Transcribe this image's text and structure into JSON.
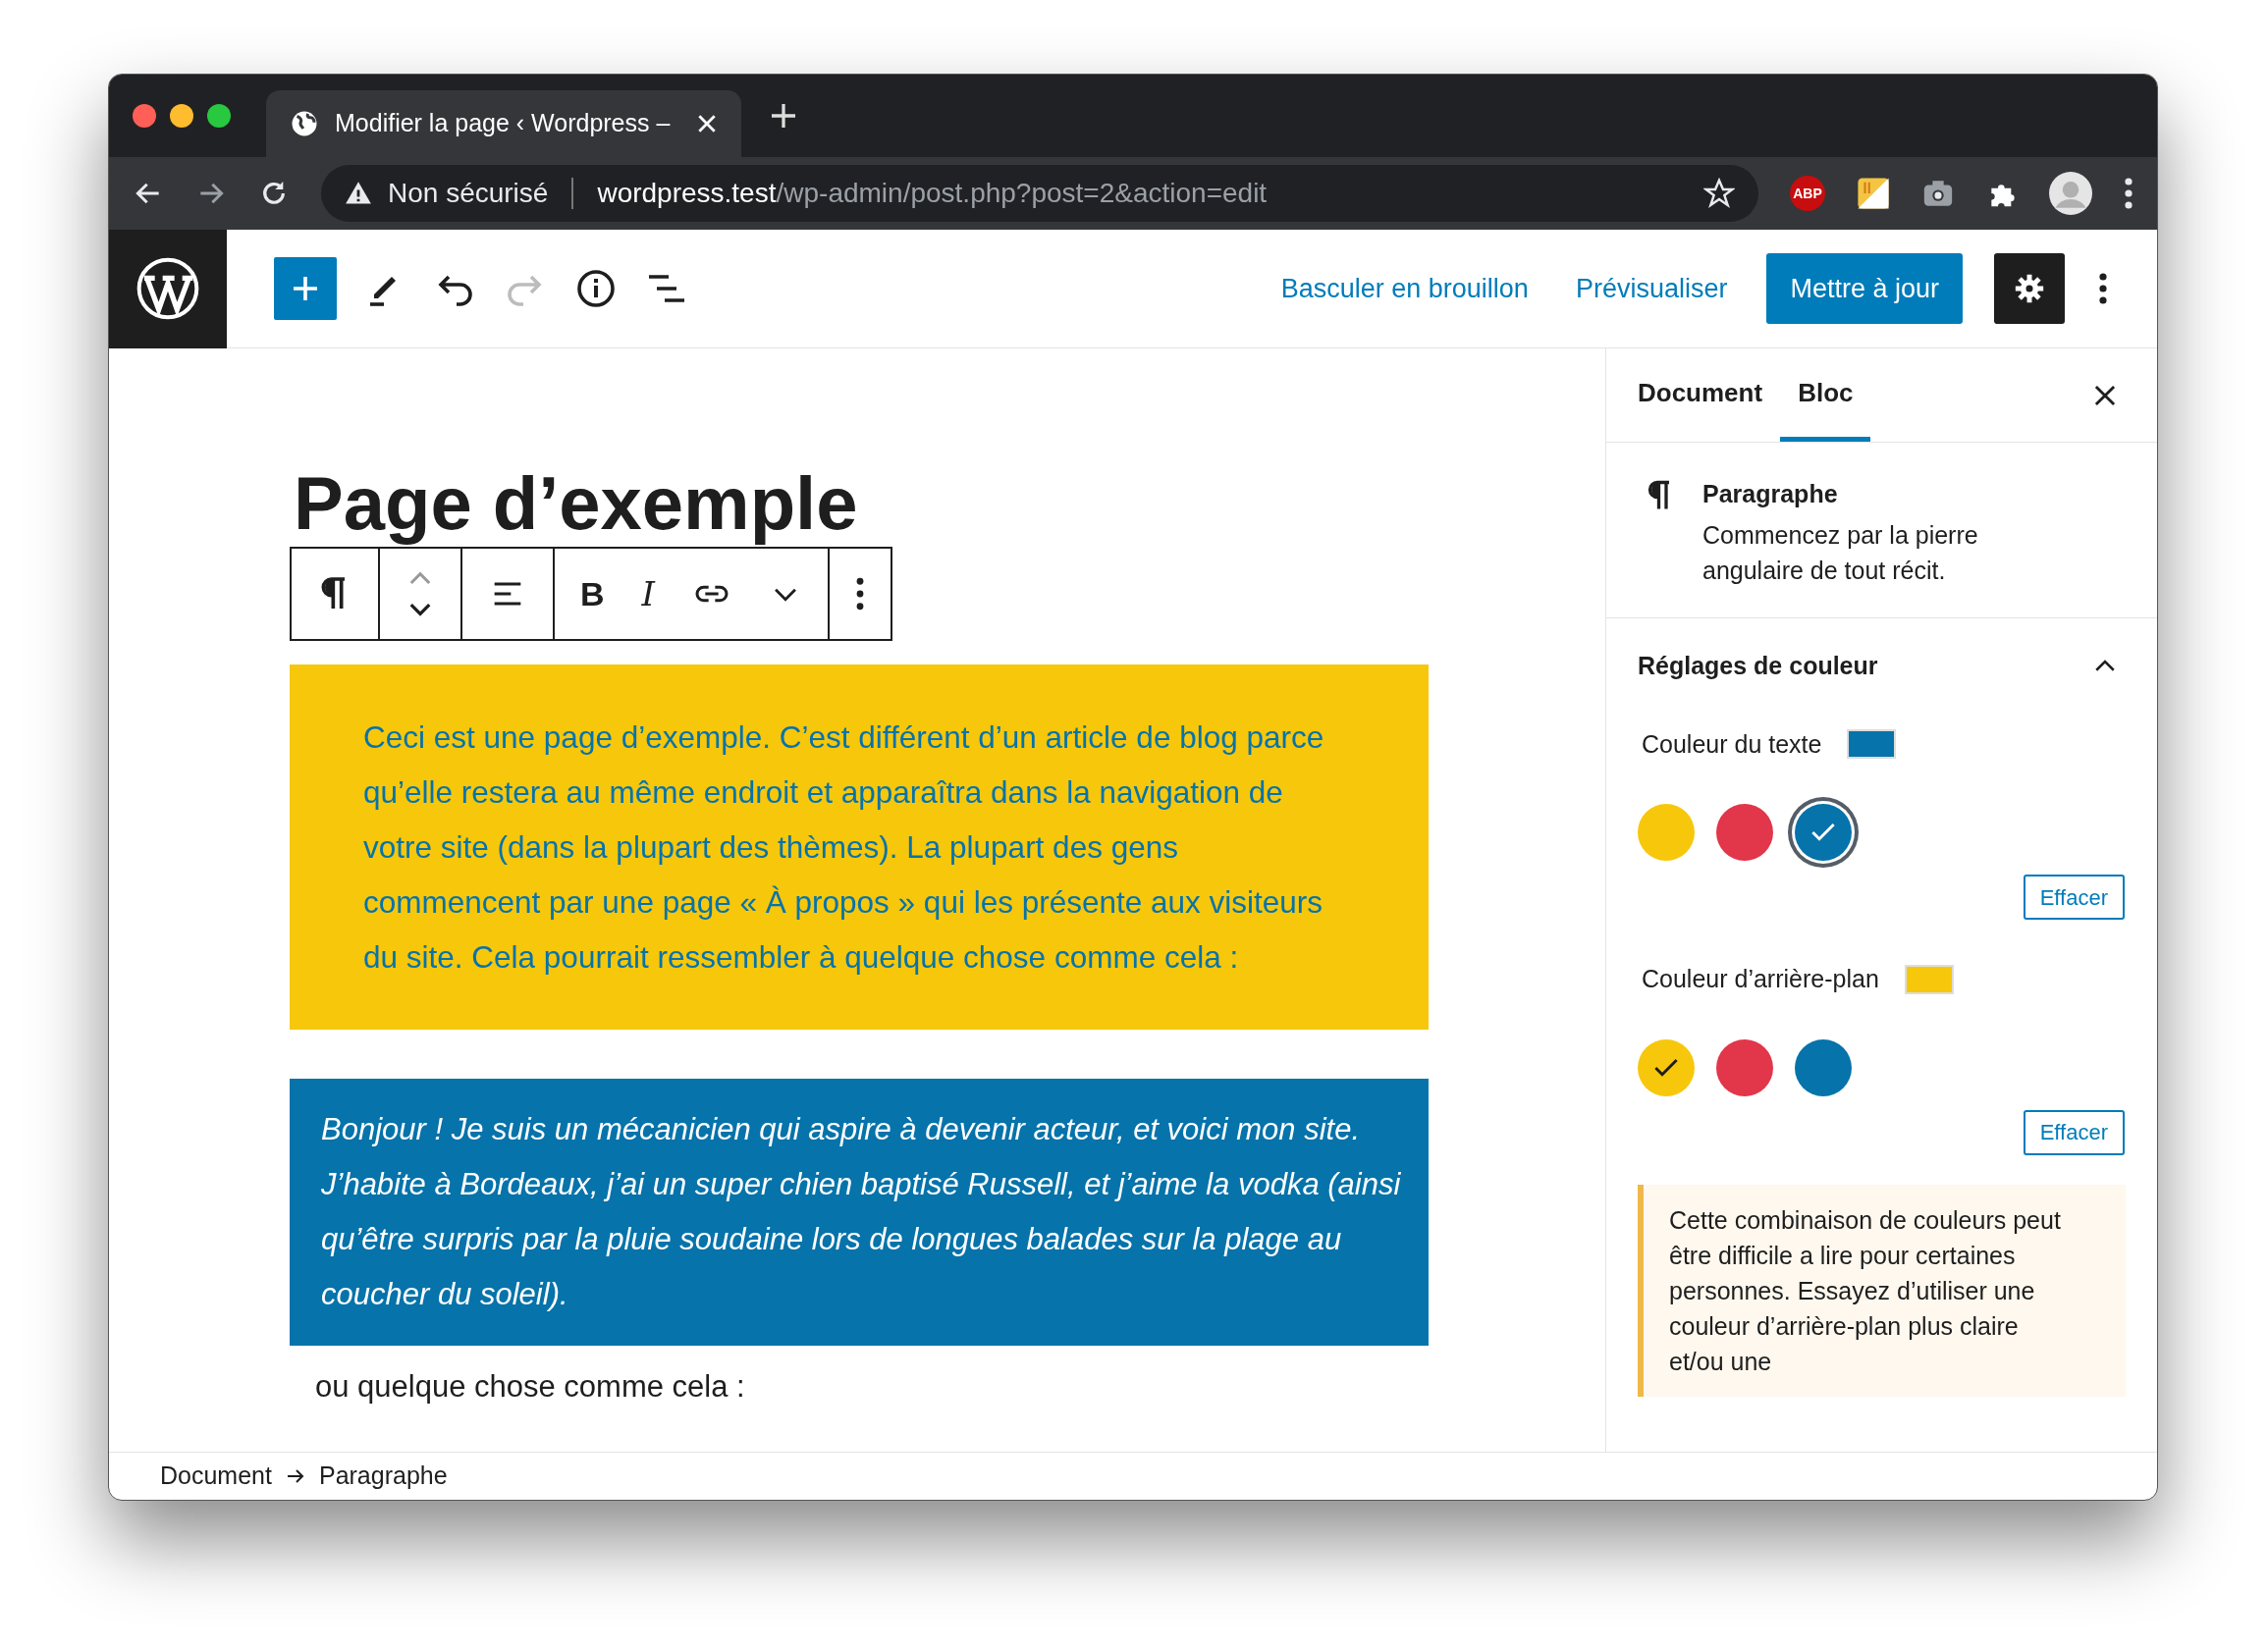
{
  "browser": {
    "tab": {
      "title": "Modifier la page ‹ Wordpress –"
    },
    "address": {
      "security": "Non sécurisé",
      "host": "wordpress.test",
      "path": "/wp-admin/post.php?post=2&action=edit"
    },
    "extensions": [
      {
        "kind": "adblock",
        "label": "ABP"
      },
      {
        "kind": "notes"
      },
      {
        "kind": "camera"
      },
      {
        "kind": "puzzle"
      },
      {
        "kind": "avatar"
      }
    ]
  },
  "toolbar": {
    "tools": [
      {
        "kind": "add",
        "disabled": false
      },
      {
        "kind": "edit",
        "disabled": false
      },
      {
        "kind": "undo",
        "disabled": false
      },
      {
        "kind": "redo",
        "disabled": true
      },
      {
        "kind": "info",
        "disabled": false
      },
      {
        "kind": "outline",
        "disabled": false
      }
    ],
    "links": [
      "Basculer en brouillon",
      "Prévisualiser"
    ],
    "primary": "Mettre à jour",
    "settings_active": true
  },
  "editor": {
    "title": "Page d’exemple",
    "block_toolbar": [
      [
        {
          "kind": "paragraph"
        }
      ],
      [
        {
          "kind": "mover"
        }
      ],
      [
        {
          "kind": "align"
        }
      ],
      [
        {
          "kind": "text",
          "label": "B"
        },
        {
          "kind": "text",
          "label": "I"
        },
        {
          "kind": "link"
        },
        {
          "kind": "more"
        }
      ],
      [
        {
          "kind": "dots"
        }
      ]
    ],
    "blocks": [
      {
        "kind": "paragraph",
        "text": "Ceci est une page d’exemple. C’est différent d’un article de blog parce qu’elle restera au même endroit et apparaîtra dans la navigation de votre site (dans la plupart des thèmes). La plupart des gens commencent par une page « À propos » qui les présente aux visiteurs du site. Cela pourrait ressembler à quelque chose comme cela :"
      },
      {
        "kind": "quote",
        "text": "Bonjour ! Je suis un mécanicien qui aspire à devenir acteur, et voici mon site. J’habite à Bordeaux, j’ai un super chien baptisé Russell, et j’aime la vodka (ainsi qu’être surpris par la pluie soudaine lors de longues balades sur la plage au coucher du soleil)."
      },
      {
        "kind": "plain",
        "text": "ou quelque chose comme cela :"
      }
    ]
  },
  "sidebar": {
    "tabs": [
      {
        "label": "Document",
        "selected": false
      },
      {
        "label": "Bloc",
        "selected": true
      }
    ],
    "block_card": {
      "title": "Paragraphe",
      "description": "Commencez par la pierre angulaire de tout récit."
    },
    "color_settings": {
      "title": "Réglages de couleur",
      "expanded": true,
      "groups": [
        {
          "label": "Couleur du texte",
          "color": "#0673aa",
          "palette": [
            {
              "color": "#f7c70c",
              "selected": false
            },
            {
              "color": "#e2364a",
              "selected": false
            },
            {
              "color": "#0673aa",
              "selected": true
            }
          ],
          "clear": "Effacer"
        },
        {
          "label": "Couleur d’arrière-plan",
          "color": "#f7c70c",
          "palette": [
            {
              "color": "#f7c70c",
              "selected": true
            },
            {
              "color": "#e2364a",
              "selected": false
            },
            {
              "color": "#0673aa",
              "selected": false
            }
          ],
          "clear": "Effacer"
        }
      ]
    },
    "notice": "Cette combinaison de couleurs peut être difficile a lire pour certaines personnes. Essayez d’utiliser une couleur d’arrière-plan plus claire et/ou une"
  },
  "breadcrumb": [
    "Document",
    "Paragraphe"
  ]
}
